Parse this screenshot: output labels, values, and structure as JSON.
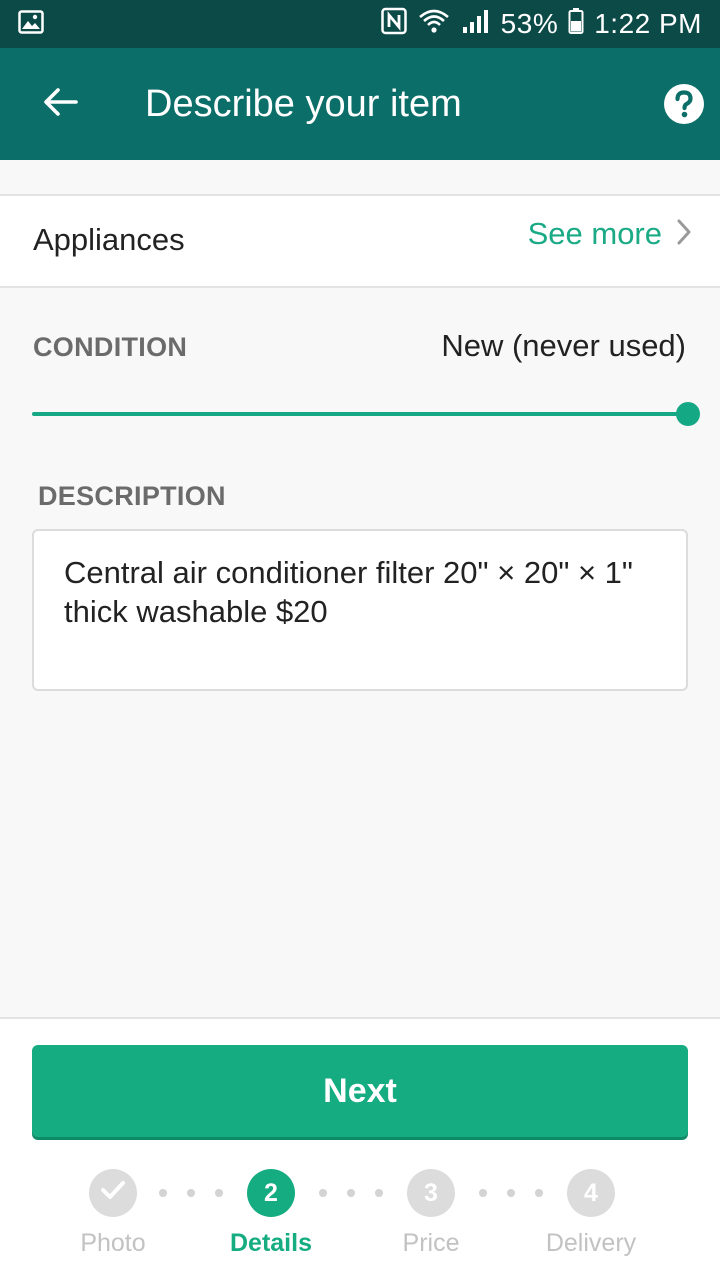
{
  "status_bar": {
    "battery": "53%",
    "time": "1:22 PM"
  },
  "app_bar": {
    "title": "Describe your item"
  },
  "category": {
    "name": "Appliances",
    "see_more_label": "See more"
  },
  "condition": {
    "label": "CONDITION",
    "value": "New (never used)",
    "slider_level_percent": 100
  },
  "description": {
    "label": "DESCRIPTION",
    "text": "Central air conditioner filter 20\" × 20\" × 1\" thick washable $20"
  },
  "next_button": {
    "label": "Next"
  },
  "steps": [
    {
      "number": "",
      "label": "Photo",
      "state": "completed"
    },
    {
      "number": "2",
      "label": "Details",
      "state": "active"
    },
    {
      "number": "3",
      "label": "Price",
      "state": "upcoming"
    },
    {
      "number": "4",
      "label": "Delivery",
      "state": "upcoming"
    }
  ],
  "colors": {
    "status_bar": "#0b4a47",
    "app_bar": "#0b6e69",
    "accent": "#14ac80",
    "inactive": "#dcdcdc"
  }
}
